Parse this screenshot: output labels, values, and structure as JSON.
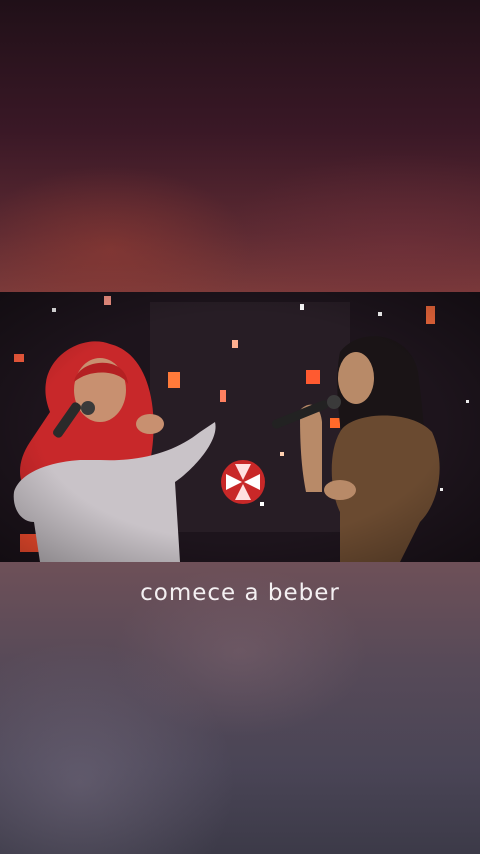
{
  "subtitle": {
    "text": "comece a beber"
  }
}
